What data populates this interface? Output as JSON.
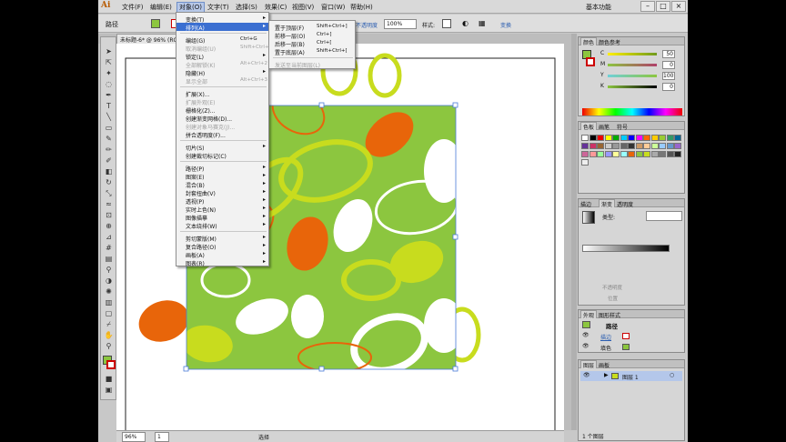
{
  "menubar": {
    "items": [
      "文件(F)",
      "编辑(E)",
      "对象(O)",
      "文字(T)",
      "选择(S)",
      "效果(C)",
      "视图(V)",
      "窗口(W)",
      "帮助(H)"
    ],
    "workspace": "基本功能"
  },
  "control": {
    "path_label": "路径",
    "opacity_label": "不透明度",
    "opacity_value": "100%",
    "style_label": "样式:",
    "transform_label": "变换"
  },
  "document_tab": "未标题-6* @ 96% (RGB/预览)",
  "object_menu": {
    "items": [
      {
        "label": "变换(T)",
        "shortcut": "",
        "submenu": true,
        "disabled": false
      },
      {
        "label": "排列(A)",
        "shortcut": "",
        "submenu": true,
        "disabled": false,
        "highlighted": true
      },
      {
        "sep": true
      },
      {
        "label": "编组(G)",
        "shortcut": "Ctrl+G",
        "disabled": false
      },
      {
        "label": "取消编组(U)",
        "shortcut": "Shift+Ctrl+G",
        "disabled": true
      },
      {
        "label": "锁定(L)",
        "shortcut": "",
        "submenu": true,
        "disabled": false
      },
      {
        "label": "全部解锁(K)",
        "shortcut": "Alt+Ctrl+2",
        "disabled": true
      },
      {
        "label": "隐藏(H)",
        "shortcut": "",
        "submenu": true,
        "disabled": false
      },
      {
        "label": "显示全部",
        "shortcut": "Alt+Ctrl+3",
        "disabled": true
      },
      {
        "sep": true
      },
      {
        "label": "扩展(X)...",
        "shortcut": "",
        "disabled": false
      },
      {
        "label": "扩展外观(E)",
        "shortcut": "",
        "disabled": true
      },
      {
        "label": "栅格化(Z)...",
        "shortcut": "",
        "disabled": false
      },
      {
        "label": "创建渐变网格(D)...",
        "shortcut": "",
        "disabled": false
      },
      {
        "label": "创建对象马赛克(J)...",
        "shortcut": "",
        "disabled": true
      },
      {
        "label": "拼合透明度(F)...",
        "shortcut": "",
        "disabled": false
      },
      {
        "sep": true
      },
      {
        "label": "切片(S)",
        "shortcut": "",
        "submenu": true,
        "disabled": false
      },
      {
        "label": "创建裁切标记(C)",
        "shortcut": "",
        "disabled": false
      },
      {
        "sep": true
      },
      {
        "label": "路径(P)",
        "shortcut": "",
        "submenu": true,
        "disabled": false
      },
      {
        "label": "图案(E)",
        "shortcut": "",
        "submenu": true,
        "disabled": false
      },
      {
        "label": "混合(B)",
        "shortcut": "",
        "submenu": true,
        "disabled": false
      },
      {
        "label": "封套扭曲(V)",
        "shortcut": "",
        "submenu": true,
        "disabled": false
      },
      {
        "label": "透视(P)",
        "shortcut": "",
        "submenu": true,
        "disabled": false
      },
      {
        "label": "实时上色(N)",
        "shortcut": "",
        "submenu": true,
        "disabled": false
      },
      {
        "label": "图像描摹",
        "shortcut": "",
        "submenu": true,
        "disabled": false
      },
      {
        "label": "文本绕排(W)",
        "shortcut": "",
        "submenu": true,
        "disabled": false
      },
      {
        "sep": true
      },
      {
        "label": "剪切蒙版(M)",
        "shortcut": "",
        "submenu": true,
        "disabled": false
      },
      {
        "label": "复合路径(O)",
        "shortcut": "",
        "submenu": true,
        "disabled": false
      },
      {
        "label": "画板(A)",
        "shortcut": "",
        "submenu": true,
        "disabled": false
      },
      {
        "label": "图表(R)",
        "shortcut": "",
        "submenu": true,
        "disabled": false
      }
    ]
  },
  "arrange_submenu": {
    "items": [
      {
        "label": "置于顶层(F)",
        "shortcut": "Shift+Ctrl+]",
        "disabled": false
      },
      {
        "label": "前移一层(O)",
        "shortcut": "Ctrl+]",
        "disabled": false
      },
      {
        "label": "后移一层(B)",
        "shortcut": "Ctrl+[",
        "disabled": false
      },
      {
        "label": "置于底层(A)",
        "shortcut": "Shift+Ctrl+[",
        "disabled": false
      },
      {
        "sep": true
      },
      {
        "label": "发送至当前图层(L)",
        "shortcut": "",
        "disabled": true
      }
    ]
  },
  "color_panel": {
    "tabs": [
      "颜色",
      "颜色参考"
    ],
    "channels": [
      {
        "name": "C",
        "value": "50"
      },
      {
        "name": "M",
        "value": "0"
      },
      {
        "name": "Y",
        "value": "100"
      },
      {
        "name": "K",
        "value": "0"
      }
    ],
    "fill_color": "#8cc63f"
  },
  "swatches_panel": {
    "tabs": [
      "色板",
      "画笔",
      "符号"
    ]
  },
  "gradient_panel": {
    "tabs": [
      "描边",
      "渐变",
      "透明度"
    ],
    "type_label": "类型:",
    "opacity_label": "不透明度",
    "position_label": "位置"
  },
  "appearance_panel": {
    "tabs": [
      "外观",
      "图形样式"
    ],
    "title": "路径",
    "rows": [
      "描边",
      "填色"
    ]
  },
  "layers_panel": {
    "tabs": [
      "图层",
      "画板"
    ],
    "layer_name": "图层 1",
    "footer": "1 个图层"
  },
  "statusbar": {
    "zoom": "96%",
    "page": "1",
    "tool": "选择"
  },
  "colors": {
    "green": "#8cc63f",
    "lime": "#c8dc1e",
    "orange": "#e8650a",
    "white": "#ffffff",
    "menu_highlight": "#3b6fd1"
  }
}
